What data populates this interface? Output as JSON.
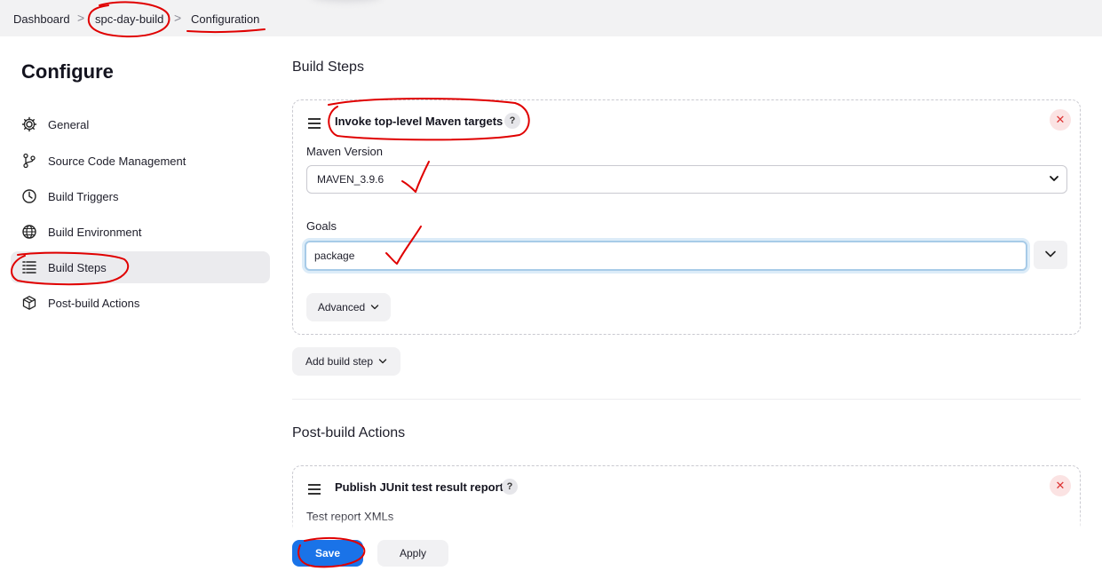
{
  "breadcrumb": {
    "items": [
      "Dashboard",
      "spc-day-build",
      "Configuration"
    ],
    "separator": ">"
  },
  "sidebar": {
    "title": "Configure",
    "items": [
      {
        "label": "General",
        "icon": "gear-icon"
      },
      {
        "label": "Source Code Management",
        "icon": "branch-icon"
      },
      {
        "label": "Build Triggers",
        "icon": "clock-icon"
      },
      {
        "label": "Build Environment",
        "icon": "globe-icon"
      },
      {
        "label": "Build Steps",
        "icon": "list-icon",
        "active": true
      },
      {
        "label": "Post-build Actions",
        "icon": "package-icon"
      }
    ]
  },
  "build_steps": {
    "heading": "Build Steps",
    "step": {
      "title": "Invoke top-level Maven targets",
      "help": "?",
      "close": "✕",
      "maven_version_label": "Maven Version",
      "maven_version_value": "MAVEN_3.9.6",
      "goals_label": "Goals",
      "goals_value": "package",
      "advanced_label": "Advanced"
    },
    "add_button": "Add build step"
  },
  "post_build": {
    "heading": "Post-build Actions",
    "action": {
      "title": "Publish JUnit test result report",
      "help": "?",
      "close": "✕",
      "field_label": "Test report XMLs"
    }
  },
  "footer": {
    "save_label": "Save",
    "apply_label": "Apply"
  },
  "colors": {
    "accent": "#1a73e8",
    "annotation": "#e00000",
    "active_bg": "#ebebee"
  }
}
